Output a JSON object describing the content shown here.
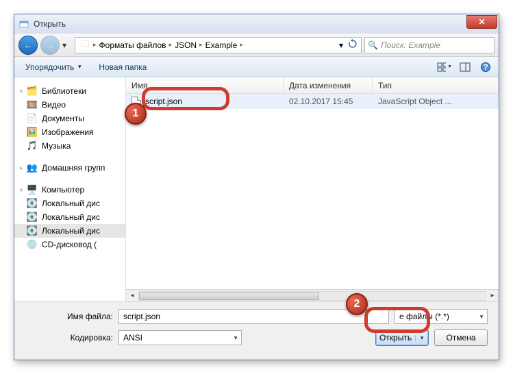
{
  "window": {
    "title": "Открыть"
  },
  "nav": {
    "path_segments": [
      "Форматы файлов",
      "JSON",
      "Example"
    ],
    "search_placeholder": "Поиск: Example"
  },
  "toolbar": {
    "organize": "Упорядочить",
    "new_folder": "Новая папка"
  },
  "sidebar": {
    "libraries": {
      "label": "Библиотеки",
      "items": [
        "Видео",
        "Документы",
        "Изображения",
        "Музыка"
      ]
    },
    "homegroup": {
      "label": "Домашняя групп"
    },
    "computer": {
      "label": "Компьютер",
      "items": [
        "Локальный дис",
        "Локальный дис",
        "Локальный дис",
        "CD-дисковод ("
      ]
    }
  },
  "columns": {
    "name": "Имя",
    "date": "Дата изменения",
    "type": "Тип"
  },
  "files": [
    {
      "name": "script.json",
      "date": "02.10.2017 15:45",
      "type": "JavaScript Object ..."
    }
  ],
  "form": {
    "filename_label": "Имя файла:",
    "filename_value": "script.json",
    "filetype_value": "е файлы  (*.*)",
    "encoding_label": "Кодировка:",
    "encoding_value": "ANSI",
    "open_label": "Открыть",
    "cancel_label": "Отмена"
  },
  "callouts": {
    "one": "1",
    "two": "2"
  }
}
